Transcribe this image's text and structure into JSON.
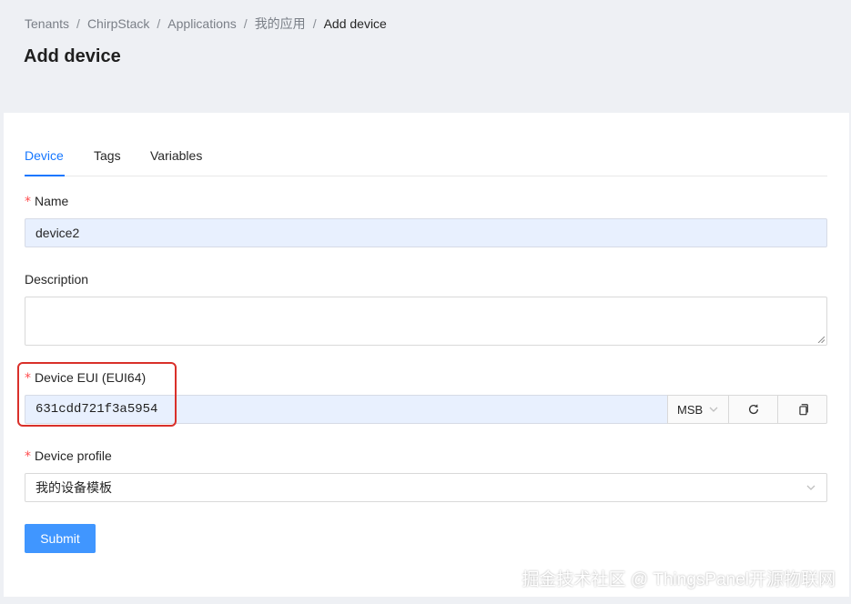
{
  "breadcrumb": {
    "items": [
      "Tenants",
      "ChirpStack",
      "Applications",
      "我的应用"
    ],
    "separator": "/",
    "current": "Add device"
  },
  "page_title": "Add device",
  "tabs": [
    {
      "label": "Device",
      "active": true
    },
    {
      "label": "Tags",
      "active": false
    },
    {
      "label": "Variables",
      "active": false
    }
  ],
  "form": {
    "required_mark": "*",
    "name": {
      "label": "Name",
      "value": "device2",
      "required": true
    },
    "description": {
      "label": "Description",
      "value": ""
    },
    "dev_eui": {
      "label": "Device EUI (EUI64)",
      "value": "631cdd721f3a5954",
      "byte_order": "MSB",
      "required": true
    },
    "device_profile": {
      "label": "Device profile",
      "value": "我的设备模板",
      "required": true
    },
    "submit_label": "Submit"
  },
  "watermark": "掘金技术社区 @ ThingsPanel开源物联网",
  "colors": {
    "accent": "#1677ff",
    "submit": "#4096ff",
    "required": "#ff4d4f",
    "highlight": "#d9302a",
    "autofill": "#e8f0fe",
    "header_bg": "#eef0f4"
  },
  "icons": {
    "byte_order_chevron": "chevron-down-icon",
    "refresh": "refresh-icon",
    "copy": "copy-icon",
    "select_chevron": "chevron-down-icon"
  }
}
